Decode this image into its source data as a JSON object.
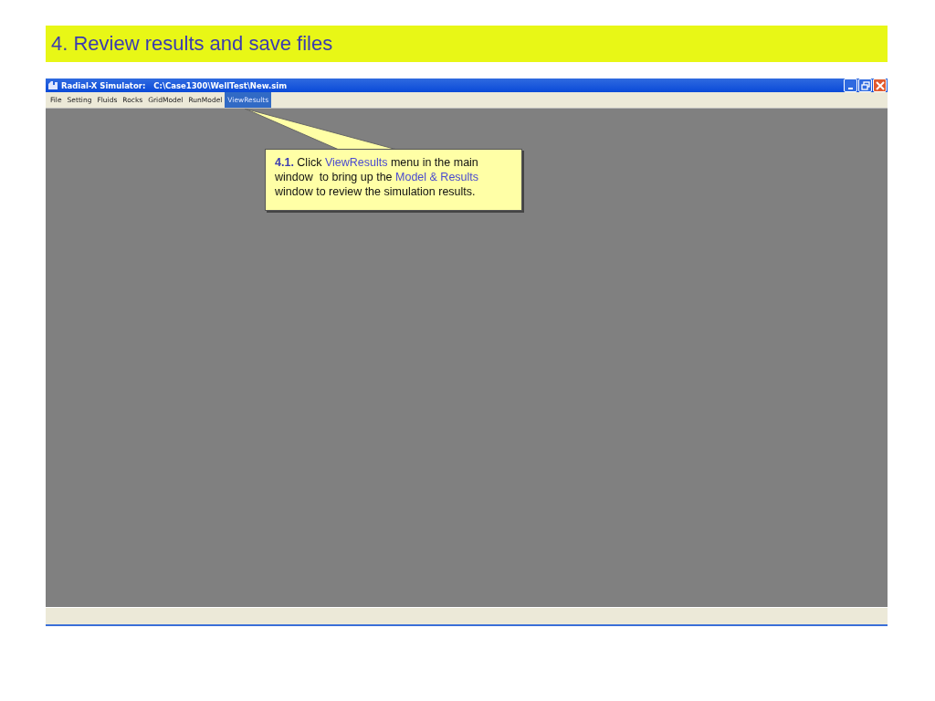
{
  "slide_title": "4. Review results and save files",
  "window": {
    "title": "Radial-X Simulator:   C:\\Case1300\\WellTest\\New.sim"
  },
  "menu": [
    {
      "label": "File",
      "selected": false
    },
    {
      "label": "Setting",
      "selected": false
    },
    {
      "label": "Fluids",
      "selected": false
    },
    {
      "label": "Rocks",
      "selected": false
    },
    {
      "label": "GridModel",
      "selected": false
    },
    {
      "label": "RunModel",
      "selected": false
    },
    {
      "label": "ViewResults",
      "selected": true
    }
  ],
  "callout": {
    "segments": [
      {
        "kind": "number",
        "text": "4.1."
      },
      {
        "kind": "plain",
        "text": " Click "
      },
      {
        "kind": "link",
        "text": "ViewResults"
      },
      {
        "kind": "plain",
        "text": " menu in the main window  to bring up the "
      },
      {
        "kind": "link",
        "text": "Model & Results"
      },
      {
        "kind": "plain",
        "text": " window to review the simulation results."
      }
    ]
  }
}
